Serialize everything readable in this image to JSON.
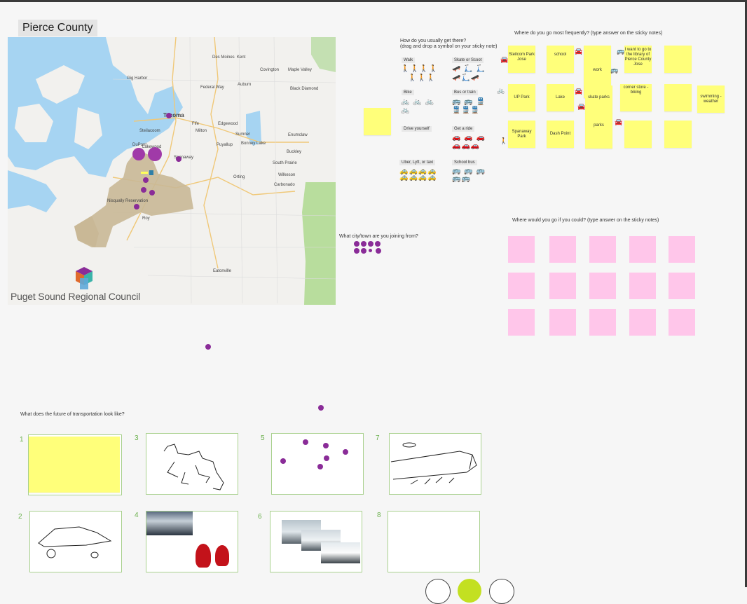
{
  "board": {
    "title": "Pierce County",
    "logo_text": "Puget Sound Regional Council"
  },
  "map": {
    "labels": [
      {
        "t": "Des Moines"
      },
      {
        "t": "Kent"
      },
      {
        "t": "Covington"
      },
      {
        "t": "Maple Valley"
      },
      {
        "t": "Gig Harbor"
      },
      {
        "t": "Federal Way"
      },
      {
        "t": "Auburn"
      },
      {
        "t": "Black Diamond"
      },
      {
        "t": "Tacoma"
      },
      {
        "t": "Puyallup"
      },
      {
        "t": "Lakewood"
      },
      {
        "t": "Sumner"
      },
      {
        "t": "Bonney Lake"
      },
      {
        "t": "Enumclaw"
      },
      {
        "t": "Buckley"
      },
      {
        "t": "Spanaway"
      },
      {
        "t": "South Prairie"
      },
      {
        "t": "Wilkeson"
      },
      {
        "t": "Carbonado"
      },
      {
        "t": "Orting"
      },
      {
        "t": "Fife"
      },
      {
        "t": "Milton"
      },
      {
        "t": "Edgewood"
      },
      {
        "t": "Roy"
      },
      {
        "t": "Nisqually Reservation"
      },
      {
        "t": "Eatonville"
      },
      {
        "t": "DuPont"
      },
      {
        "t": "Steilacoom"
      }
    ]
  },
  "questions": {
    "travel": "How do you usually get there?",
    "travel_sub": "(drag and drop a symbol on your sticky note)",
    "frequent": "Where do you go most frequently? (type answer on the sticky notes)",
    "wish": "Where would you go if you could? (type answer on the sticky notes)",
    "city": "What city/town are you joining from?",
    "future": "What does the future of transportation look like?"
  },
  "modes": [
    {
      "label": "Walk",
      "icons": "🚶🚶🚶🚶"
    },
    {
      "label": "Skate or Scoot",
      "icons": "🛹 🛴 🛴"
    },
    {
      "label": "Bike",
      "icons": "🚲 🚲 🚲"
    },
    {
      "label": "Bus or train",
      "icons": "🚌 🚌 🚆"
    },
    {
      "label": "Drive yourself",
      "icons": ""
    },
    {
      "label": "Get a ride",
      "icons": "🚗 🚗 🚗"
    },
    {
      "label": "Uber, Lyft, or taxi",
      "icons": "🚕🚕🚕🚕"
    },
    {
      "label": "School bus",
      "icons": "🚌 🚌 🚌"
    }
  ],
  "frequent_notes": [
    {
      "t": "Steilcom Park Jose"
    },
    {
      "t": "school"
    },
    {
      "t": "work"
    },
    {
      "t": "I want to go to the library of Pierce County Jose"
    },
    {
      "t": ""
    },
    {
      "t": "UP Park"
    },
    {
      "t": "Lake"
    },
    {
      "t": "skate parks"
    },
    {
      "t": "corner store - biking"
    },
    {
      "t": ""
    },
    {
      "t": "swimming - weather"
    },
    {
      "t": "Spanaway Park"
    },
    {
      "t": "Dash Point"
    },
    {
      "t": "parks"
    },
    {
      "t": ""
    },
    {
      "t": ""
    }
  ],
  "future_panels": [
    {
      "n": "1"
    },
    {
      "n": "3"
    },
    {
      "n": "5"
    },
    {
      "n": "7"
    },
    {
      "n": "2"
    },
    {
      "n": "4"
    },
    {
      "n": "6"
    },
    {
      "n": "8"
    }
  ],
  "colors": {
    "sticky_yellow": "#ffff7a",
    "sticky_pink": "#ffc6ea",
    "dot_purple": "#8a2c98",
    "panel_border": "#a9d18e",
    "icon_blue": "#2f7fa8",
    "nav_green": "#c3e021"
  }
}
